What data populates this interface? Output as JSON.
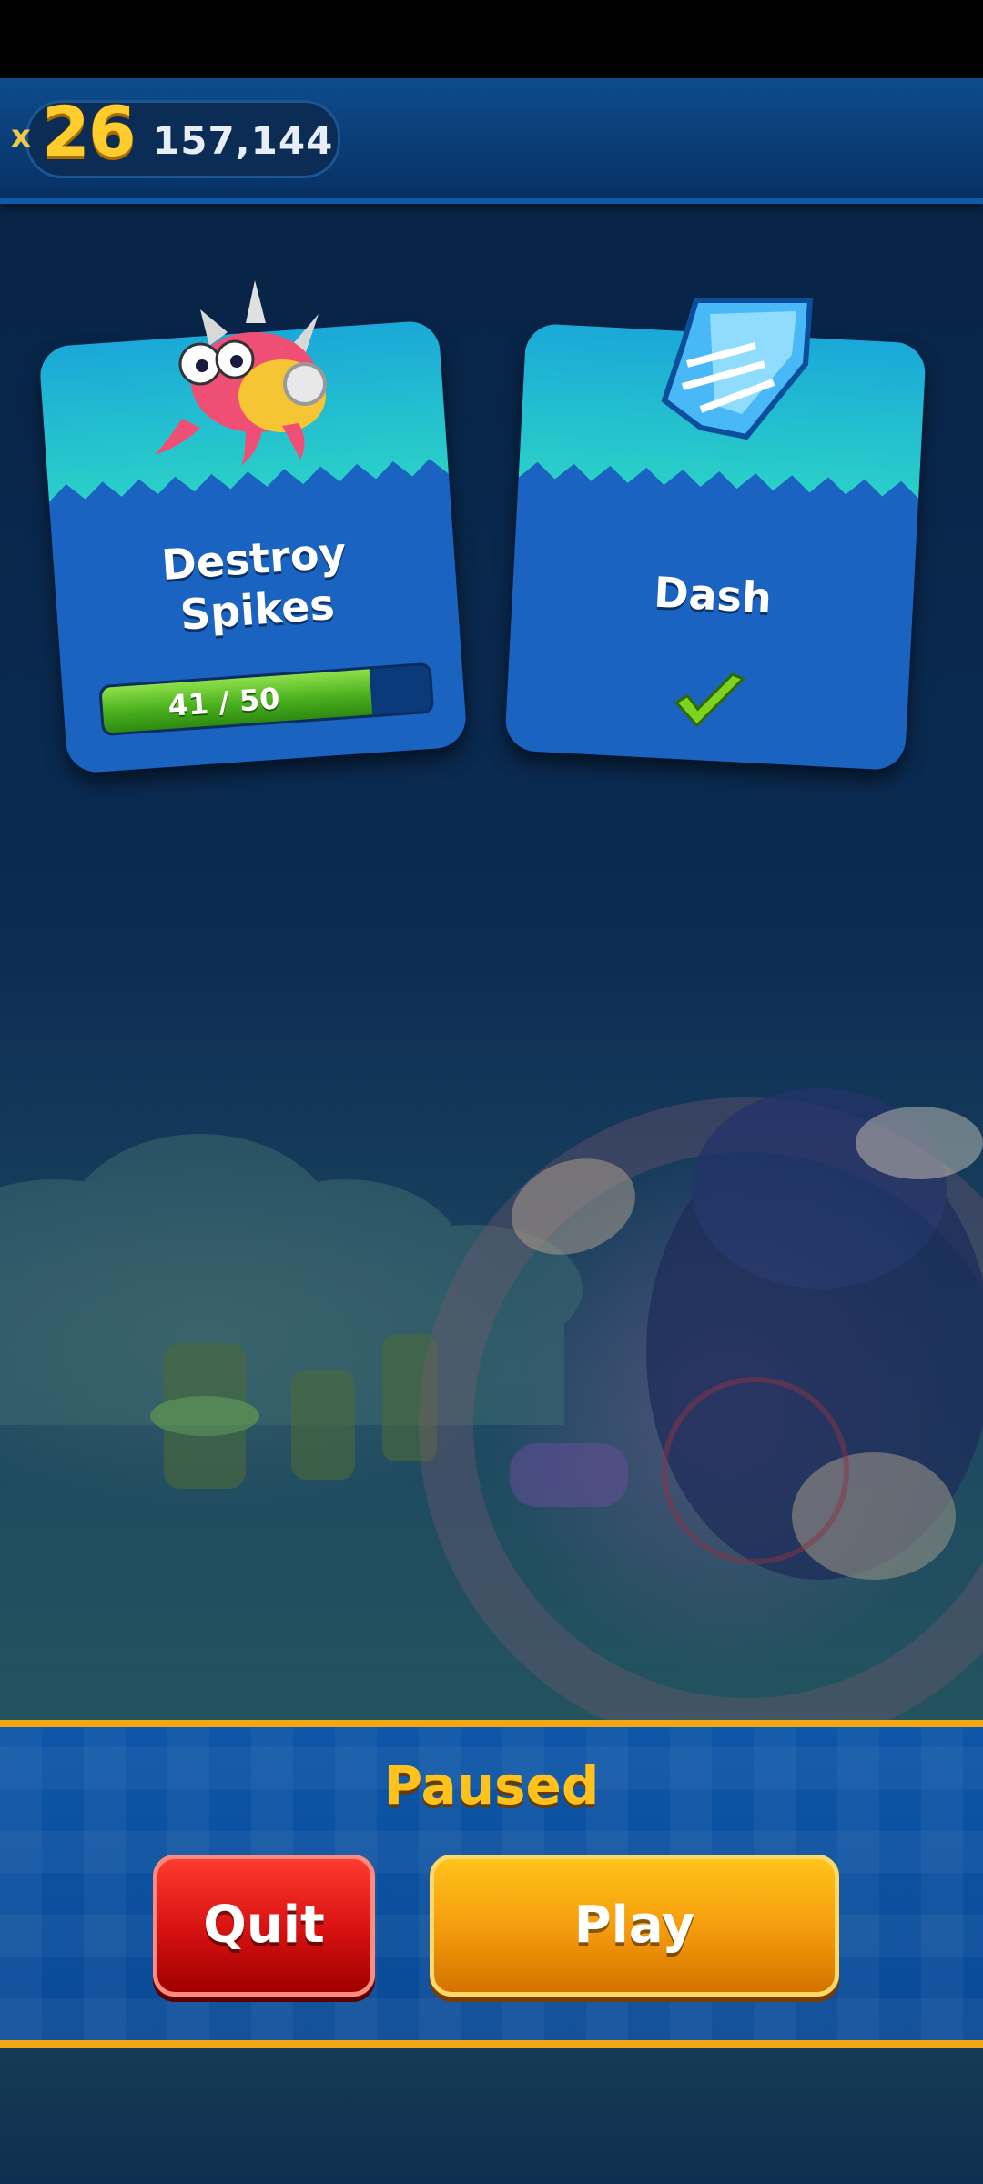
{
  "hud": {
    "multiplier_prefix": "x",
    "multiplier": "26",
    "score": "157,144"
  },
  "missions": [
    {
      "title_line1": "Destroy",
      "title_line2": "Spikes",
      "icon": "spike-crab-badnik-icon",
      "progress_text": "41 / 50",
      "progress": 0.82
    },
    {
      "title": "Dash",
      "icon": "blue-dash-crystal-icon",
      "completed": true,
      "status_icon": "green-checkmark-icon"
    }
  ],
  "pause_panel": {
    "title": "Paused",
    "quit_label": "Quit",
    "play_label": "Play"
  },
  "colors": {
    "accent_gold": "#ffc21c",
    "quit_red": "#d51010",
    "play_orange": "#f49a0c",
    "progress_green": "#4ab01e"
  }
}
